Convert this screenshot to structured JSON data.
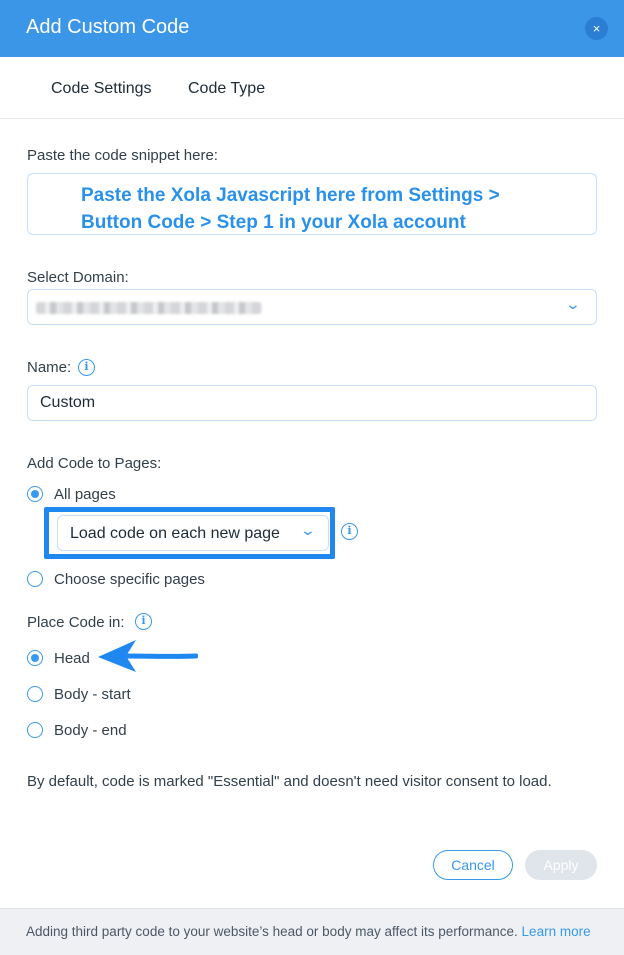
{
  "header": {
    "title": "Add Custom Code",
    "close_icon": "×"
  },
  "tabs": [
    {
      "label": "Code Settings"
    },
    {
      "label": "Code Type"
    }
  ],
  "snippet": {
    "label": "Paste the code snippet here:",
    "annotation": "Paste the Xola Javascript here from Settings > Button Code > Step 1 in your Xola account"
  },
  "domain": {
    "label": "Select Domain:",
    "value_redacted": true,
    "chevron_icon": "⌄"
  },
  "name": {
    "label": "Name:",
    "value": "Custom",
    "info_icon": "i"
  },
  "add_to_pages": {
    "label": "Add Code to Pages:",
    "options": [
      {
        "label": "All pages",
        "selected": true
      },
      {
        "label": "Choose specific pages",
        "selected": false
      }
    ],
    "load_select": {
      "value": "Load code on each new page",
      "chevron_icon": "⌄"
    },
    "info_icon": "i"
  },
  "place_code": {
    "label": "Place Code in:",
    "info_icon": "i",
    "options": [
      {
        "label": "Head",
        "selected": true
      },
      {
        "label": "Body - start",
        "selected": false
      },
      {
        "label": "Body - end",
        "selected": false
      }
    ]
  },
  "consent_note": "By default, code is marked \"Essential\" and doesn't need visitor consent to load.",
  "buttons": {
    "cancel": "Cancel",
    "apply": "Apply"
  },
  "footer": {
    "text": "Adding third party code to your website’s head or body may affect its performance.",
    "link": "Learn more"
  },
  "colors": {
    "header": "#3b96e8",
    "accent": "#3899ec",
    "annotation": "#1e88f0"
  },
  "icons": [
    "close-icon",
    "chevron-down-icon",
    "info-icon",
    "arrow-annotation-icon"
  ]
}
